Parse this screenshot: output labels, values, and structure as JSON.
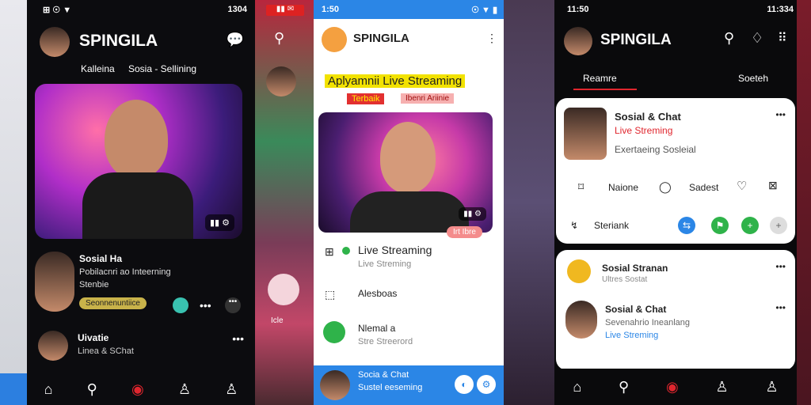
{
  "screen1": {
    "status": {
      "time": "1304"
    },
    "app_name": "SPINGILA",
    "tabs": [
      "Kalleina",
      "Sosia - Sellining"
    ],
    "feed": [
      {
        "name": "Sosial Ha",
        "line1": "Pobilacnri ao Inteerning",
        "line2": "Stenbie",
        "tag": "Seonnenuntiice"
      },
      {
        "name": "Uivatie",
        "line1": "Linea & SChat"
      }
    ]
  },
  "screen2": {
    "status": {
      "time": "1:50"
    },
    "app_name": "SPINGILA",
    "headline": "Aplyamnii Live Streaming",
    "badge1": "Terbaik",
    "badge2": "Ibenri Ariinie",
    "hero_chip": "Irt Ibre",
    "list": [
      {
        "title": "Live Streaming",
        "sub": "Live Streming"
      },
      {
        "title": "Alesboas"
      },
      {
        "title": "Nlemal a",
        "sub": "Stre Streerord"
      }
    ],
    "bottom": {
      "title": "Socia & Chat",
      "sub": "Sustel eeseming"
    }
  },
  "screen3": {
    "status": {
      "time": "11:50",
      "right": "11:334"
    },
    "app_name": "SPINGILA",
    "tabs": [
      "Reamre",
      "Soeteh"
    ],
    "card1": {
      "title": "Sosial & Chat",
      "sub": "Live Streming",
      "line": "Exertaeing Sosleial",
      "actions": [
        "Naione",
        "Sadest"
      ],
      "chip": "Steriank"
    },
    "list": [
      {
        "title": "Sosial Stranan",
        "sub": "Ultres Sostat"
      },
      {
        "title": "Sosial & Chat",
        "sub": "Sevenahrio Ineanlang",
        "extra": "Live Streming"
      }
    ]
  },
  "side": {
    "label": "Icle"
  },
  "colors": {
    "accent_red": "#e0262e",
    "blue": "#2b86e6",
    "green": "#2fb34a"
  }
}
